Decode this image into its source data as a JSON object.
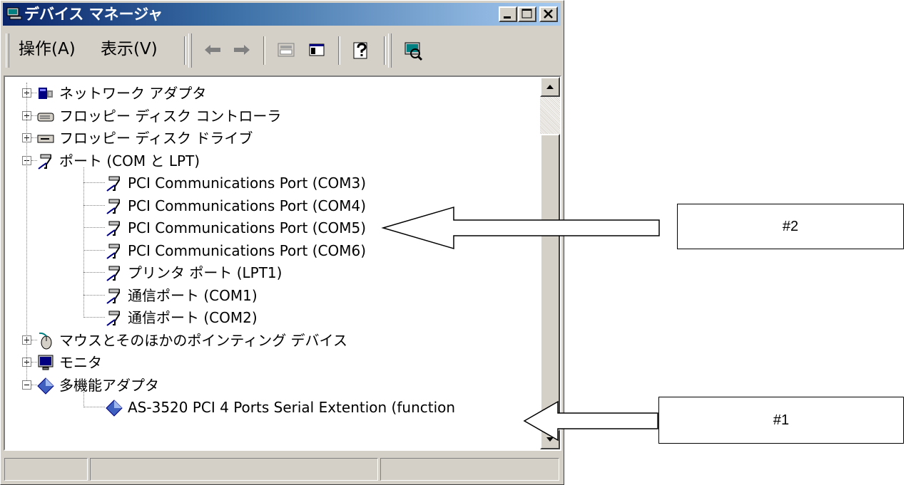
{
  "window": {
    "title": "デバイス マネージャ",
    "menu": [
      {
        "label": "操作(A)",
        "name": "menu-action"
      },
      {
        "label": "表示(V)",
        "name": "menu-view"
      }
    ]
  },
  "tree": {
    "items": [
      {
        "label": "ネットワーク アダプタ",
        "icon": "network-adapter-icon",
        "level": 0,
        "expander": "plus"
      },
      {
        "label": "フロッピー ディスク コントローラ",
        "icon": "floppy-controller-icon",
        "level": 0,
        "expander": "plus"
      },
      {
        "label": "フロッピー ディスク ドライブ",
        "icon": "floppy-drive-icon",
        "level": 0,
        "expander": "plus"
      },
      {
        "label": "ポート (COM と LPT)",
        "icon": "port-icon",
        "level": 0,
        "expander": "minus"
      },
      {
        "label": "PCI Communications Port (COM3)",
        "icon": "port-icon",
        "level": 1
      },
      {
        "label": "PCI Communications Port (COM4)",
        "icon": "port-icon",
        "level": 1
      },
      {
        "label": "PCI Communications Port (COM5)",
        "icon": "port-icon",
        "level": 1
      },
      {
        "label": "PCI Communications Port (COM6)",
        "icon": "port-icon",
        "level": 1
      },
      {
        "label": "プリンタ ポート (LPT1)",
        "icon": "port-icon",
        "level": 1
      },
      {
        "label": "通信ポート (COM1)",
        "icon": "port-icon",
        "level": 1
      },
      {
        "label": "通信ポート (COM2)",
        "icon": "port-icon",
        "level": 1
      },
      {
        "label": "マウスとそのほかのポインティング デバイス",
        "icon": "mouse-icon",
        "level": 0,
        "expander": "plus"
      },
      {
        "label": "モニタ",
        "icon": "monitor-icon",
        "level": 0,
        "expander": "plus"
      },
      {
        "label": "多機能アダプタ",
        "icon": "multifunction-icon",
        "level": 0,
        "expander": "minus"
      },
      {
        "label": "AS-3520 PCI 4 Ports Serial Extention (function",
        "icon": "multifunction-icon",
        "level": 1
      }
    ]
  },
  "annotations": {
    "box2": "#2",
    "box1": "#1"
  }
}
